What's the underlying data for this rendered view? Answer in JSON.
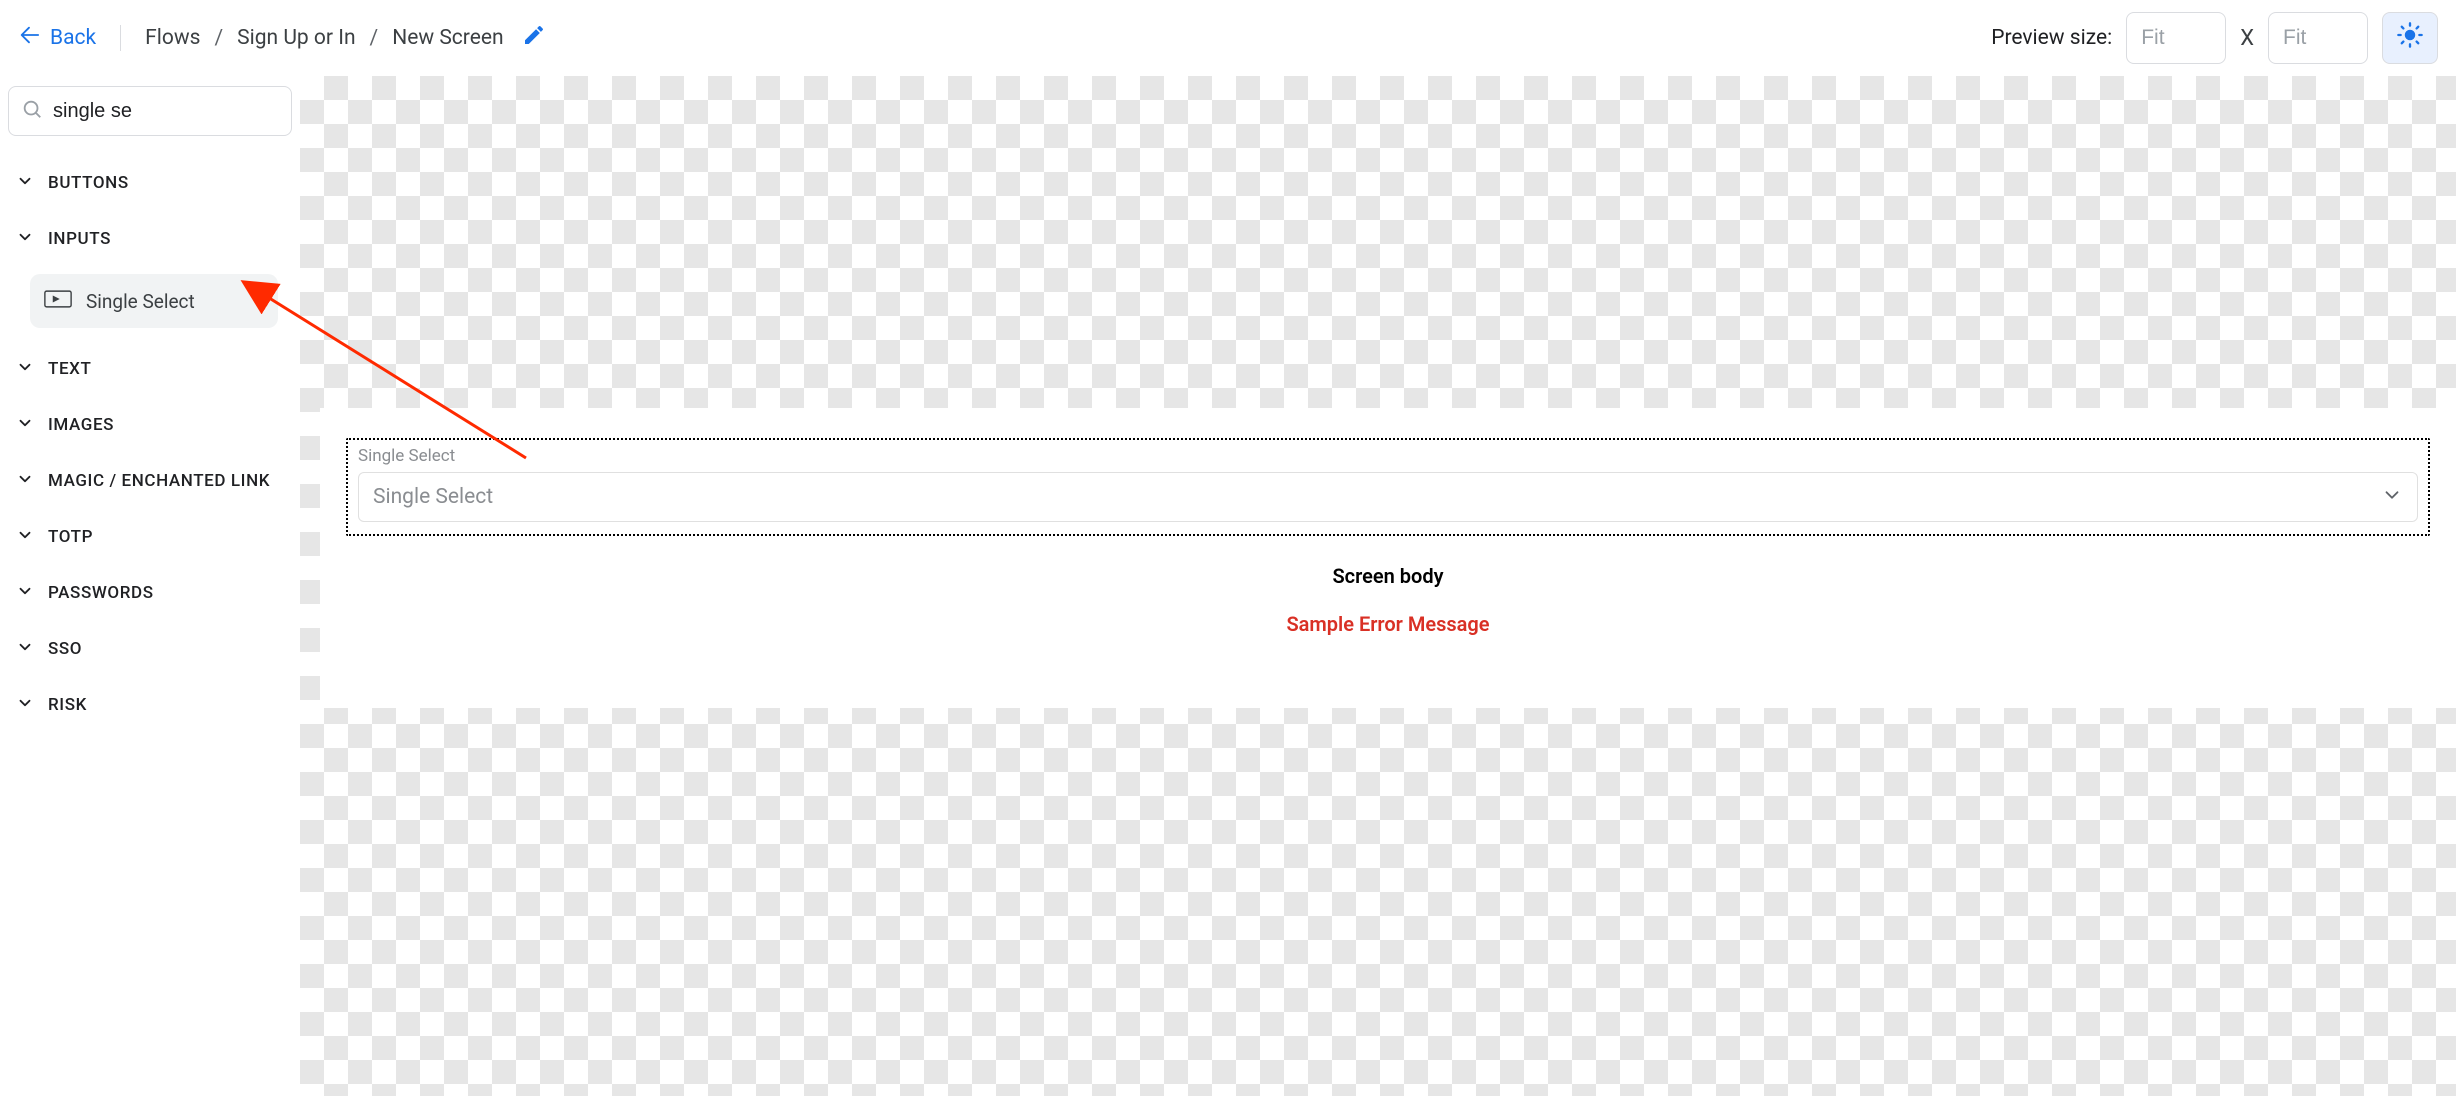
{
  "topbar": {
    "back_label": "Back",
    "crumbs": [
      "Flows",
      "Sign Up or In",
      "New Screen"
    ]
  },
  "preview": {
    "label": "Preview size:",
    "width_placeholder": "Fit",
    "height_placeholder": "Fit",
    "x_sep": "X"
  },
  "sidebar": {
    "search_value": "single se",
    "categories": [
      "BUTTONS",
      "INPUTS",
      "TEXT",
      "IMAGES",
      "MAGIC / ENCHANTED LINK",
      "TOTP",
      "PASSWORDS",
      "SSO",
      "RISK"
    ],
    "input_item_label": "Single Select"
  },
  "canvas": {
    "single_select_label": "Single Select",
    "single_select_placeholder": "Single Select",
    "screen_body_text": "Screen body",
    "error_text": "Sample Error Message"
  }
}
